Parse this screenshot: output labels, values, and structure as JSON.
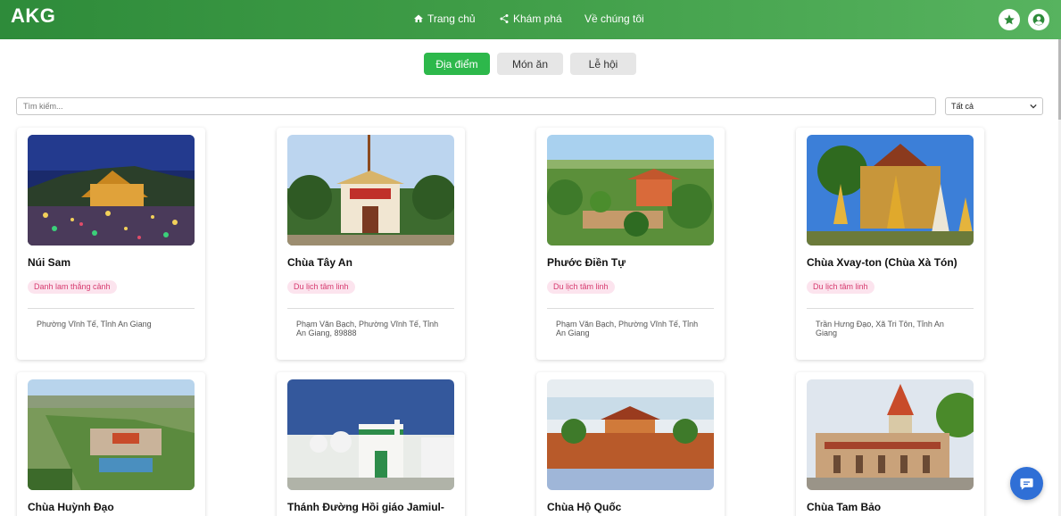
{
  "header": {
    "logo": "AKG",
    "nav": [
      {
        "label": "Trang chủ",
        "icon": "home-icon"
      },
      {
        "label": "Khám phá",
        "icon": "share-icon"
      },
      {
        "label": "Về chúng tôi",
        "icon": ""
      }
    ],
    "buttons": [
      {
        "icon": "star-icon"
      },
      {
        "icon": "user-icon"
      }
    ]
  },
  "tabs": [
    {
      "label": "Địa điểm",
      "active": true
    },
    {
      "label": "Món ăn",
      "active": false
    },
    {
      "label": "Lễ hội",
      "active": false
    }
  ],
  "search": {
    "placeholder": "Tìm kiếm...",
    "value": ""
  },
  "filter": {
    "selected": "Tất cả"
  },
  "cards": [
    {
      "title": "Núi Sam",
      "badge": "Danh lam thắng cảnh",
      "address": "Phường Vĩnh Tế, Tỉnh An Giang"
    },
    {
      "title": "Chùa Tây An",
      "badge": "Du lịch tâm linh",
      "address": "Phạm Văn Bạch, Phường Vĩnh Tế, Tỉnh An Giang, 89888"
    },
    {
      "title": "Phước Điền Tự",
      "badge": "Du lịch tâm linh",
      "address": "Phạm Văn Bạch, Phường Vĩnh Tế, Tỉnh An Giang"
    },
    {
      "title": "Chùa Xvay-ton (Chùa Xà Tón)",
      "badge": "Du lịch tâm linh",
      "address": "Trần Hưng Đạo, Xã Tri Tôn, Tỉnh An Giang"
    },
    {
      "title": "Chùa Huỳnh Đạo",
      "badge": "",
      "address": ""
    },
    {
      "title": "Thánh Đường Hồi giáo Jamiul-",
      "badge": "",
      "address": ""
    },
    {
      "title": "Chùa Hộ Quốc",
      "badge": "",
      "address": ""
    },
    {
      "title": "Chùa Tam Bảo",
      "badge": "",
      "address": ""
    }
  ],
  "colors": {
    "header_start": "#2e8b3a",
    "header_end": "#57b35f",
    "tab_active": "#2db84b",
    "badge_bg": "#fce4ee",
    "badge_text": "#d63b6f",
    "chat": "#2f6fd6"
  },
  "chat_button": {
    "icon": "chat-icon"
  }
}
